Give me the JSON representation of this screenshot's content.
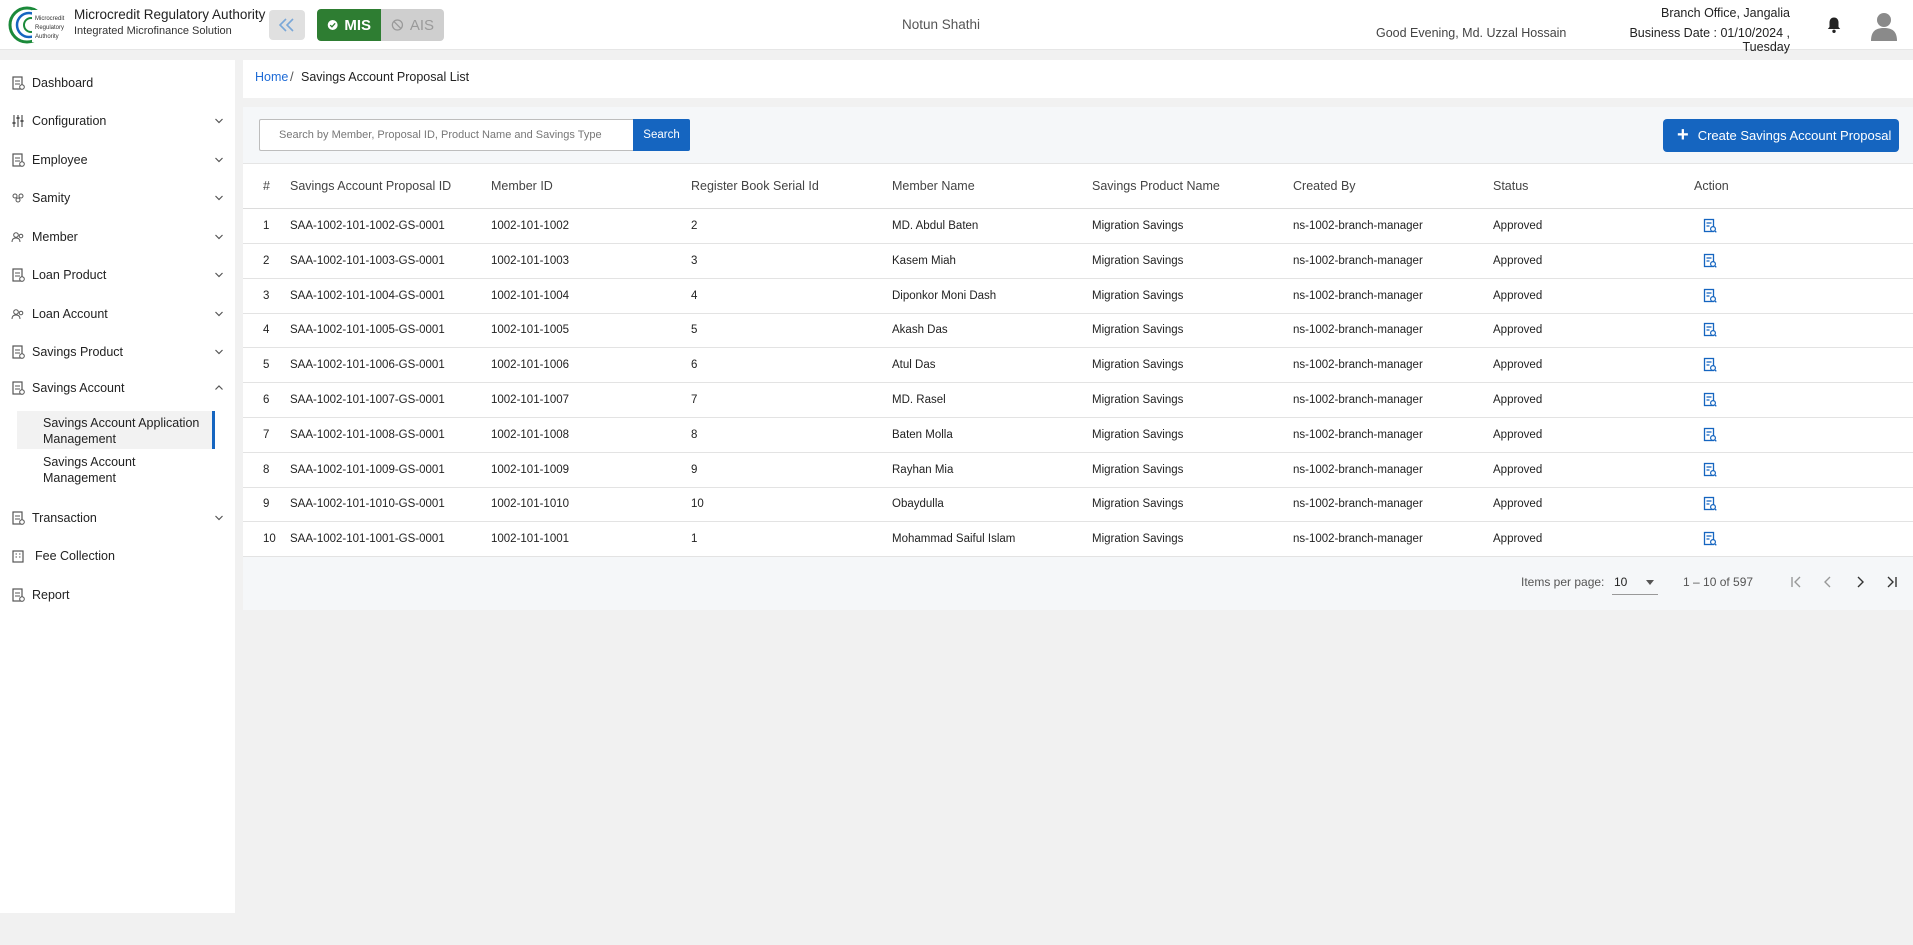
{
  "header": {
    "org_title": "Microcredit Regulatory Authority",
    "org_subtitle": "Integrated Microfinance Solution",
    "logo_text": [
      "Microcredit",
      "Regulatory",
      "Authority"
    ],
    "mode_mis": "MIS",
    "mode_ais": "AIS",
    "app_name": "Notun Shathi",
    "greeting": "Good Evening, Md. Uzzal Hossain",
    "branch": "Branch Office, Jangalia",
    "business_date": "Business Date : 01/10/2024 , Tuesday"
  },
  "sidebar": {
    "items": [
      {
        "label": "Dashboard",
        "icon": "document-icon",
        "expandable": false
      },
      {
        "label": "Configuration",
        "icon": "sliders-icon",
        "expandable": true
      },
      {
        "label": "Employee",
        "icon": "document-icon",
        "expandable": true
      },
      {
        "label": "Samity",
        "icon": "group-icon",
        "expandable": true
      },
      {
        "label": "Member",
        "icon": "people-icon",
        "expandable": true
      },
      {
        "label": "Loan Product",
        "icon": "document-icon",
        "expandable": true
      },
      {
        "label": "Loan Account",
        "icon": "people-icon",
        "expandable": true
      },
      {
        "label": "Savings Product",
        "icon": "document-icon",
        "expandable": true
      },
      {
        "label": "Savings Account",
        "icon": "document-icon",
        "expandable": true,
        "expanded": true
      },
      {
        "label": "Transaction",
        "icon": "document-icon",
        "expandable": true
      },
      {
        "label": "Fee Collection",
        "icon": "building-icon",
        "expandable": false
      },
      {
        "label": "Report",
        "icon": "document-icon",
        "expandable": false
      }
    ],
    "sub_items": [
      {
        "label": "Savings Account Application Management",
        "active": true
      },
      {
        "label": "Savings Account Management",
        "active": false
      }
    ]
  },
  "breadcrumb": {
    "home": "Home",
    "separator": "/",
    "current": "Savings Account Proposal List"
  },
  "toolbar": {
    "search_placeholder": "Search by Member, Proposal ID, Product Name and Savings Type",
    "search_label": "Search",
    "create_label": "Create Savings Account Proposal"
  },
  "table": {
    "columns": [
      "#",
      "Savings Account Proposal ID",
      "Member ID",
      "Register Book Serial Id",
      "Member Name",
      "Savings Product Name",
      "Created By",
      "Status",
      "Action"
    ],
    "rows": [
      [
        "1",
        "SAA-1002-101-1002-GS-0001",
        "1002-101-1002",
        "2",
        "MD. Abdul Baten",
        "Migration Savings",
        "ns-1002-branch-manager",
        "Approved"
      ],
      [
        "2",
        "SAA-1002-101-1003-GS-0001",
        "1002-101-1003",
        "3",
        "Kasem Miah",
        "Migration Savings",
        "ns-1002-branch-manager",
        "Approved"
      ],
      [
        "3",
        "SAA-1002-101-1004-GS-0001",
        "1002-101-1004",
        "4",
        "Diponkor Moni Dash",
        "Migration Savings",
        "ns-1002-branch-manager",
        "Approved"
      ],
      [
        "4",
        "SAA-1002-101-1005-GS-0001",
        "1002-101-1005",
        "5",
        "Akash Das",
        "Migration Savings",
        "ns-1002-branch-manager",
        "Approved"
      ],
      [
        "5",
        "SAA-1002-101-1006-GS-0001",
        "1002-101-1006",
        "6",
        "Atul Das",
        "Migration Savings",
        "ns-1002-branch-manager",
        "Approved"
      ],
      [
        "6",
        "SAA-1002-101-1007-GS-0001",
        "1002-101-1007",
        "7",
        "MD. Rasel",
        "Migration Savings",
        "ns-1002-branch-manager",
        "Approved"
      ],
      [
        "7",
        "SAA-1002-101-1008-GS-0001",
        "1002-101-1008",
        "8",
        "Baten Molla",
        "Migration Savings",
        "ns-1002-branch-manager",
        "Approved"
      ],
      [
        "8",
        "SAA-1002-101-1009-GS-0001",
        "1002-101-1009",
        "9",
        "Rayhan Mia",
        "Migration Savings",
        "ns-1002-branch-manager",
        "Approved"
      ],
      [
        "9",
        "SAA-1002-101-1010-GS-0001",
        "1002-101-1010",
        "10",
        "Obaydulla",
        "Migration Savings",
        "ns-1002-branch-manager",
        "Approved"
      ],
      [
        "10",
        "SAA-1002-101-1001-GS-0001",
        "1002-101-1001",
        "1",
        "Mohammad Saiful Islam",
        "Migration Savings",
        "ns-1002-branch-manager",
        "Approved"
      ]
    ],
    "action_icon": "view-document-icon"
  },
  "paginator": {
    "items_per_page_label": "Items per page:",
    "page_size": "10",
    "range": "1 – 10 of 597"
  },
  "colors": {
    "primary": "#1565c0",
    "mis_green": "#2e7d32",
    "link": "#1e6bd6"
  }
}
